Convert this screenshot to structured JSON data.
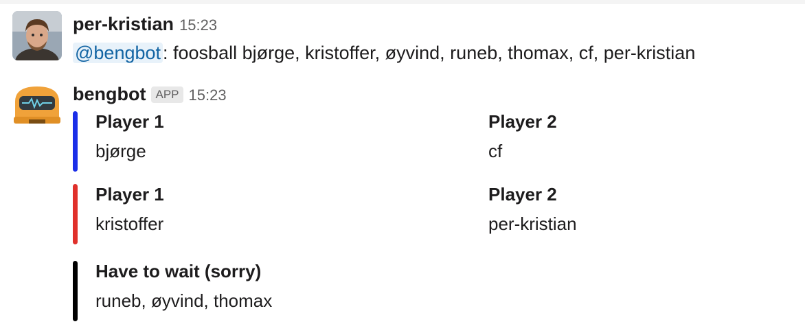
{
  "message_user": {
    "sender": "per-kristian",
    "time": "15:23",
    "mention": "@bengbot",
    "text": ": foosball bjørge, kristoffer, øyvind, runeb, thomax, cf, per-kristian"
  },
  "message_bot": {
    "sender": "bengbot",
    "badge": "APP",
    "time": "15:23",
    "attachments": [
      {
        "color": "#1a2ee8",
        "fields": [
          {
            "title": "Player 1",
            "value": "bjørge"
          },
          {
            "title": "Player 2",
            "value": "cf"
          }
        ]
      },
      {
        "color": "#e0302b",
        "fields": [
          {
            "title": "Player 1",
            "value": "kristoffer"
          },
          {
            "title": "Player 2",
            "value": "per-kristian"
          }
        ]
      },
      {
        "color": "#000000",
        "fields": [
          {
            "title": "Have to wait (sorry)",
            "value": "runeb,  øyvind,  thomax"
          }
        ]
      }
    ]
  }
}
